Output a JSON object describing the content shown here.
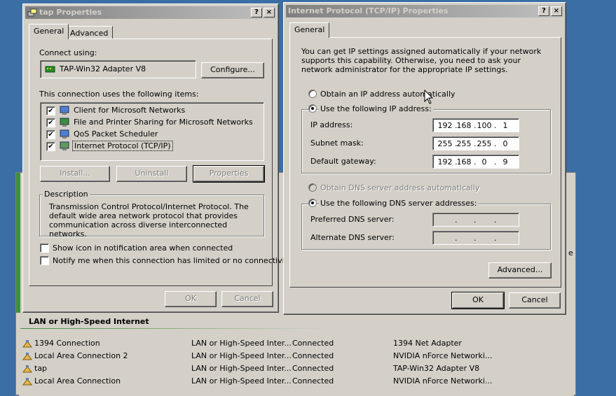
{
  "background_window": {
    "section_header": "LAN or High-Speed Internet",
    "connections": [
      {
        "name": "1394 Connection",
        "type": "LAN or High-Speed Inter...",
        "status": "Connected",
        "device": "1394 Net Adapter"
      },
      {
        "name": "Local Area Connection 2",
        "type": "LAN or High-Speed Inter...",
        "status": "Connected",
        "device": "NVIDIA nForce Networki..."
      },
      {
        "name": "tap",
        "type": "LAN or High-Speed Inter...",
        "status": "Connected",
        "device": "TAP-Win32 Adapter V8"
      },
      {
        "name": "Local Area Connection",
        "type": "LAN or High-Speed Inter...",
        "status": "Connected",
        "device": "NVIDIA nForce Networki..."
      }
    ],
    "edge_letter": "e"
  },
  "tap_dialog": {
    "title": "tap Properties",
    "help_btn": "?",
    "close_btn": "×",
    "tabs": [
      "General",
      "Advanced"
    ],
    "connect_using_label": "Connect using:",
    "adapter_name": "TAP-Win32 Adapter V8",
    "configure_btn": "Configure...",
    "items_label": "This connection uses the following items:",
    "items": [
      {
        "label": "Client for Microsoft Networks",
        "checked": true,
        "icon": "network-client-icon"
      },
      {
        "label": "File and Printer Sharing for Microsoft Networks",
        "checked": true,
        "icon": "file-sharing-icon"
      },
      {
        "label": "QoS Packet Scheduler",
        "checked": true,
        "icon": "qos-icon"
      },
      {
        "label": "Internet Protocol (TCP/IP)",
        "checked": true,
        "icon": "protocol-icon"
      }
    ],
    "install_btn": "Install...",
    "uninstall_btn": "Uninstall",
    "properties_btn": "Properties",
    "description_legend": "Description",
    "description_text": "Transmission Control Protocol/Internet Protocol. The default wide area network protocol that provides communication across diverse interconnected networks.",
    "show_icon_label": "Show icon in notification area when connected",
    "notify_label": "Notify me when this connection has limited or no connectivity",
    "ok_btn": "OK",
    "cancel_btn": "Cancel"
  },
  "tcpip_dialog": {
    "title": "Internet Protocol (TCP/IP) Properties",
    "help_btn": "?",
    "close_btn": "×",
    "tab": "General",
    "intro": "You can get IP settings assigned automatically if your network supports this capability. Otherwise, you need to ask your network administrator for the appropriate IP settings.",
    "obtain_ip_label": "Obtain an IP address automatically",
    "use_ip_label": "Use the following IP address:",
    "ip_label": "IP address:",
    "ip_value": [
      "192",
      "168",
      "100",
      "1"
    ],
    "subnet_label": "Subnet mask:",
    "subnet_value": [
      "255",
      "255",
      "255",
      "0"
    ],
    "gateway_label": "Default gateway:",
    "gateway_value": [
      "192",
      "168",
      "0",
      "9"
    ],
    "obtain_dns_label": "Obtain DNS server address automatically",
    "use_dns_label": "Use the following DNS server addresses:",
    "preferred_dns_label": "Preferred DNS server:",
    "alternate_dns_label": "Alternate DNS server:",
    "advanced_btn": "Advanced...",
    "ok_btn": "OK",
    "cancel_btn": "Cancel"
  }
}
